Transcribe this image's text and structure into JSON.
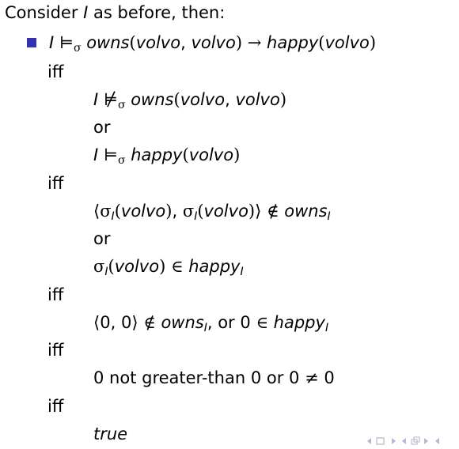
{
  "intro": "Consider I as before, then:",
  "lines": {
    "main": "I ⊨σ owns(volvo, volvo) → happy(volvo)",
    "iff": "iff",
    "or": "or",
    "a1": "I ⊭σ owns(volvo, volvo)",
    "a2": "I ⊨σ happy(volvo)",
    "b1": "⟨σI(volvo), σI(volvo)⟩ ∉ ownsI",
    "b2": "σI(volvo) ∈ happyI",
    "c1": "⟨0, 0⟩ ∉ ownsI, or 0 ∈ happyI",
    "d1": "0 not greater-than 0 or 0 ≠ 0",
    "e1": "true"
  },
  "tokens": {
    "intro_a": "Consider ",
    "intro_I": "I",
    "intro_b": " as before, then:",
    "I": "I",
    "models": "⊨",
    "notmodels": "⊭",
    "sigma": "σ",
    "sub_I": "I",
    "owns": "owns",
    "happy": "happy",
    "volvo": "volvo",
    "lparen": "(",
    "rparen": ")",
    "comma": ", ",
    "to": "→",
    "langle": "⟨",
    "rangle": "⟩",
    "notin": "∉",
    "in": "∈",
    "neq": "≠",
    "zero": "0",
    "or_comma": ", or ",
    "not_greater": " not greater-than ",
    "or_word": " or ",
    "true": "true"
  },
  "colors": {
    "bullet": "#3333b2",
    "nav": "#b6b6d6"
  },
  "icons": [
    "nav-left-arrow-icon",
    "nav-frame-icon",
    "nav-right-arrow-icon",
    "nav-section-icon"
  ]
}
